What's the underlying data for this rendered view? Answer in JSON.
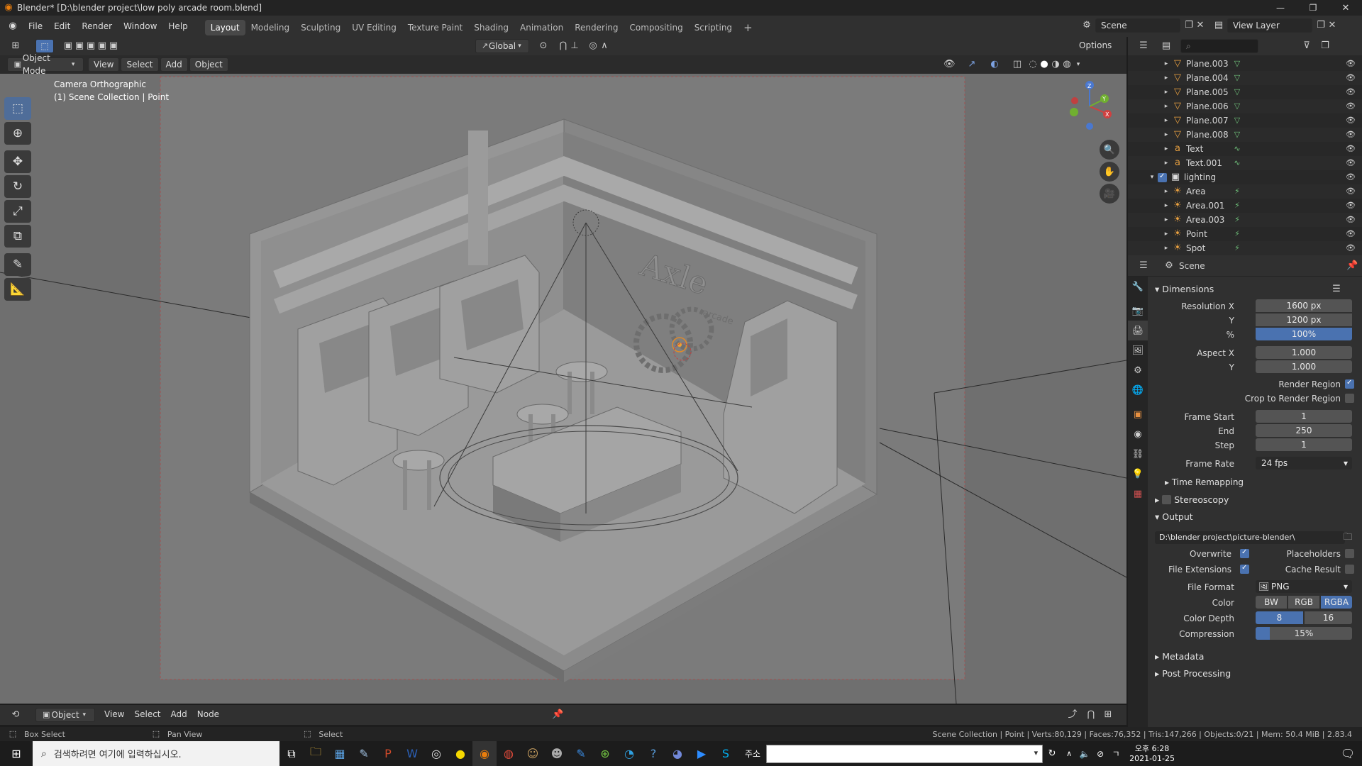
{
  "titlebar": {
    "title": "Blender* [D:\\blender project\\low poly arcade room.blend]"
  },
  "menu": [
    "File",
    "Edit",
    "Render",
    "Window",
    "Help"
  ],
  "workspaces": [
    {
      "label": "Layout",
      "active": true
    },
    {
      "label": "Modeling",
      "active": false
    },
    {
      "label": "Sculpting",
      "active": false
    },
    {
      "label": "UV Editing",
      "active": false
    },
    {
      "label": "Texture Paint",
      "active": false
    },
    {
      "label": "Shading",
      "active": false
    },
    {
      "label": "Animation",
      "active": false
    },
    {
      "label": "Rendering",
      "active": false
    },
    {
      "label": "Compositing",
      "active": false
    },
    {
      "label": "Scripting",
      "active": false
    }
  ],
  "scene_selector": {
    "scene": "Scene",
    "view_layer": "View Layer"
  },
  "viewport_header": {
    "transform": "Global",
    "options": "Options",
    "mode": "Object Mode",
    "menus": [
      "View",
      "Select",
      "Add",
      "Object"
    ]
  },
  "viewport_overlay": {
    "line1": "Camera Orthographic",
    "line2": "(1) Scene Collection | Point"
  },
  "scene_text": {
    "logo": "Axle",
    "logo_sub": "arcade"
  },
  "gizmo": {
    "z": "Z",
    "y": "Y",
    "x": "X"
  },
  "outliner": {
    "rows": [
      {
        "name": "Plane.003",
        "icon": "mesh-icon",
        "indent": 1
      },
      {
        "name": "Plane.004",
        "icon": "mesh-icon",
        "indent": 1
      },
      {
        "name": "Plane.005",
        "icon": "mesh-icon",
        "indent": 1
      },
      {
        "name": "Plane.006",
        "icon": "mesh-icon",
        "indent": 1
      },
      {
        "name": "Plane.007",
        "icon": "mesh-icon",
        "indent": 1
      },
      {
        "name": "Plane.008",
        "icon": "mesh-icon",
        "indent": 1
      },
      {
        "name": "Text",
        "icon": "text-icon",
        "indent": 1
      },
      {
        "name": "Text.001",
        "icon": "text-icon",
        "indent": 1
      },
      {
        "name": "lighting",
        "icon": "collection-icon",
        "indent": 0
      },
      {
        "name": "Area",
        "icon": "light-icon",
        "indent": 1
      },
      {
        "name": "Area.001",
        "icon": "light-icon",
        "indent": 1
      },
      {
        "name": "Area.003",
        "icon": "light-icon",
        "indent": 1
      },
      {
        "name": "Point",
        "icon": "light-icon",
        "indent": 1
      },
      {
        "name": "Spot",
        "icon": "light-icon",
        "indent": 1
      }
    ]
  },
  "properties": {
    "context": "Scene",
    "dimensions": {
      "title": "Dimensions",
      "res_x_label": "Resolution X",
      "res_x": "1600 px",
      "res_y_label": "Y",
      "res_y": "1200 px",
      "pct_label": "%",
      "pct": "100%",
      "aspect_x_label": "Aspect X",
      "aspect_x": "1.000",
      "aspect_y_label": "Y",
      "aspect_y": "1.000",
      "render_region": "Render Region",
      "crop": "Crop to Render Region",
      "frame_start_label": "Frame Start",
      "frame_start": "1",
      "end_label": "End",
      "end": "250",
      "step_label": "Step",
      "step": "1",
      "frame_rate_label": "Frame Rate",
      "frame_rate": "24 fps",
      "time_remapping": "Time Remapping"
    },
    "stereoscopy": "Stereoscopy",
    "output": {
      "title": "Output",
      "path": "D:\\blender project\\picture-blender\\",
      "overwrite": "Overwrite",
      "placeholders": "Placeholders",
      "file_extensions": "File Extensions",
      "cache_result": "Cache Result",
      "file_format_label": "File Format",
      "file_format": "PNG",
      "color_label": "Color",
      "color_options": [
        "BW",
        "RGB",
        "RGBA"
      ],
      "depth_label": "Color Depth",
      "depth_options": [
        "8",
        "16"
      ],
      "compression_label": "Compression",
      "compression": "15%",
      "compression_value": 0.15
    },
    "metadata": "Metadata",
    "post_processing": "Post Processing"
  },
  "node_header": {
    "mode": "Object",
    "menus": [
      "View",
      "Select",
      "Add",
      "Node"
    ]
  },
  "statusbar": {
    "left1": "Box Select",
    "left2": "Pan View",
    "left3": "Select",
    "right": "Scene Collection | Point | Verts:80,129 | Faces:76,352 | Tris:147,266 | Objects:0/21 | Mem: 50.4 MiB | 2.83.4"
  },
  "taskbar": {
    "search_placeholder": "검색하려면 여기에 입력하십시오.",
    "address_label": "주소",
    "time": "오후 6:28",
    "date": "2021-01-25"
  },
  "colors": {
    "accent": "#4a72b0",
    "viewport_bg": "#6f6f6f",
    "camera_frame": "#7b7b7b"
  }
}
